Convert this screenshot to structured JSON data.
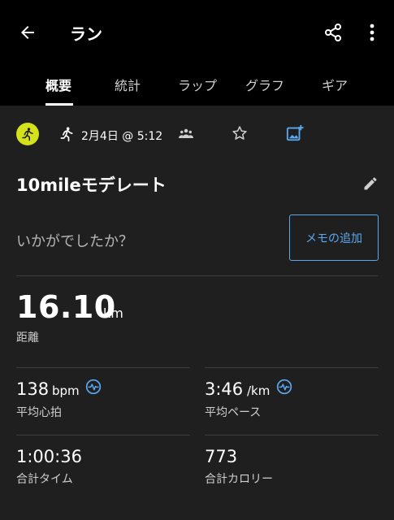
{
  "header": {
    "title": "ラン"
  },
  "tabs": [
    {
      "label": "概要",
      "active": true
    },
    {
      "label": "統計",
      "active": false
    },
    {
      "label": "ラップ",
      "active": false
    },
    {
      "label": "グラフ",
      "active": false
    },
    {
      "label": "ギア",
      "active": false
    }
  ],
  "meta": {
    "date_time": "2月4日 @ 5:12"
  },
  "activity": {
    "name": "10mileモデレート",
    "note_prompt": "いかがでしたか？",
    "add_memo_label": "メモの追加"
  },
  "stats": {
    "distance": {
      "value": "16.10",
      "unit": "km",
      "label": "距離"
    },
    "avg_hr": {
      "value": "138",
      "unit": "bpm",
      "label": "平均心拍"
    },
    "avg_pace": {
      "value": "3:46",
      "unit": "/km",
      "label": "平均ペース"
    },
    "total_time": {
      "value": "1:00:36",
      "label": "合計タイム"
    },
    "calories": {
      "value": "773",
      "label": "合計カロリー"
    }
  },
  "colors": {
    "accent": "#5aa8f0",
    "activity_badge": "#d4e11b",
    "background": "#1f1f1f",
    "appbar": "#000000"
  }
}
